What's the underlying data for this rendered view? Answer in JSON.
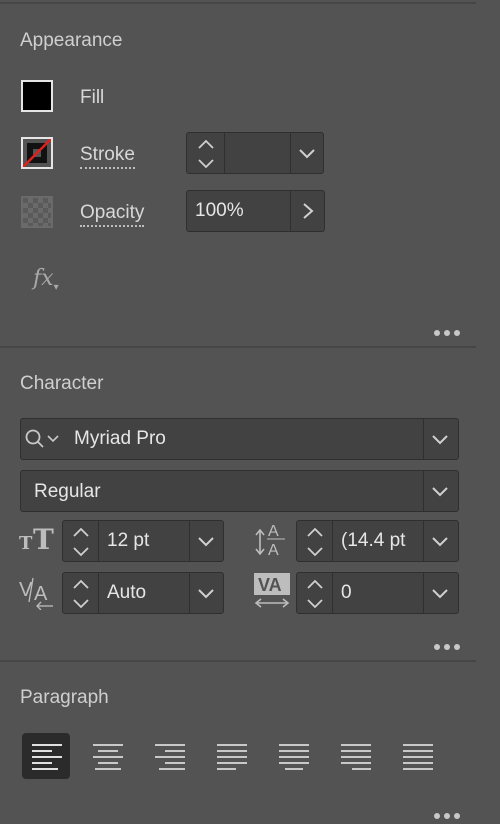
{
  "appearance": {
    "title": "Appearance",
    "fill_label": "Fill",
    "stroke_label": "Stroke",
    "stroke_value": "",
    "opacity_label": "Opacity",
    "opacity_value": "100%",
    "fx_label": "fx"
  },
  "character": {
    "title": "Character",
    "font_family": "Myriad Pro",
    "font_style": "Regular",
    "font_size": "12 pt",
    "leading": "(14.4 pt",
    "kerning": "Auto",
    "tracking": "0"
  },
  "paragraph": {
    "title": "Paragraph"
  },
  "icons": [
    "stroke-stepper-icon",
    "chevron-down-icon",
    "chevron-right-icon",
    "search-icon",
    "font-size-icon",
    "leading-icon",
    "kerning-icon",
    "tracking-icon",
    "more-options-icon",
    "fx-icon"
  ],
  "colors": {
    "panel_bg": "#535353",
    "field_bg": "#424242",
    "active_btn": "#2b2b2b"
  }
}
